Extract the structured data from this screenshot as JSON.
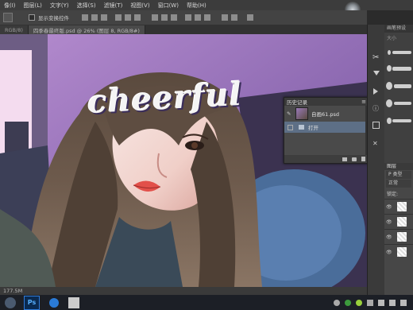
{
  "menu": {
    "items": [
      "像(I)",
      "图层(L)",
      "文字(Y)",
      "选择(S)",
      "滤镜(T)",
      "视图(V)",
      "窗口(W)",
      "帮助(H)"
    ]
  },
  "options_bar": {
    "checkbox_label": "显示变换控件"
  },
  "doc_tabs": [
    {
      "label": "RGB/8)"
    },
    {
      "label": "四季春最终版.psd @ 26% (图层 8, RGB/8#)"
    }
  ],
  "canvas": {
    "artwork_text": "cheerful"
  },
  "history_panel": {
    "title": "历史记录",
    "snapshot_name": "自画61.psd",
    "steps": [
      "打开"
    ]
  },
  "right_panel": {
    "brush_title": "画笔预设",
    "brush_size_label": "大小",
    "layers_tab": "图层",
    "kind_label": "P 类型",
    "blend_mode": "正常",
    "lock_label": "锁定:"
  },
  "status": {
    "doc_size": "177.5M"
  },
  "taskbar": {
    "ps_label": "Ps"
  }
}
